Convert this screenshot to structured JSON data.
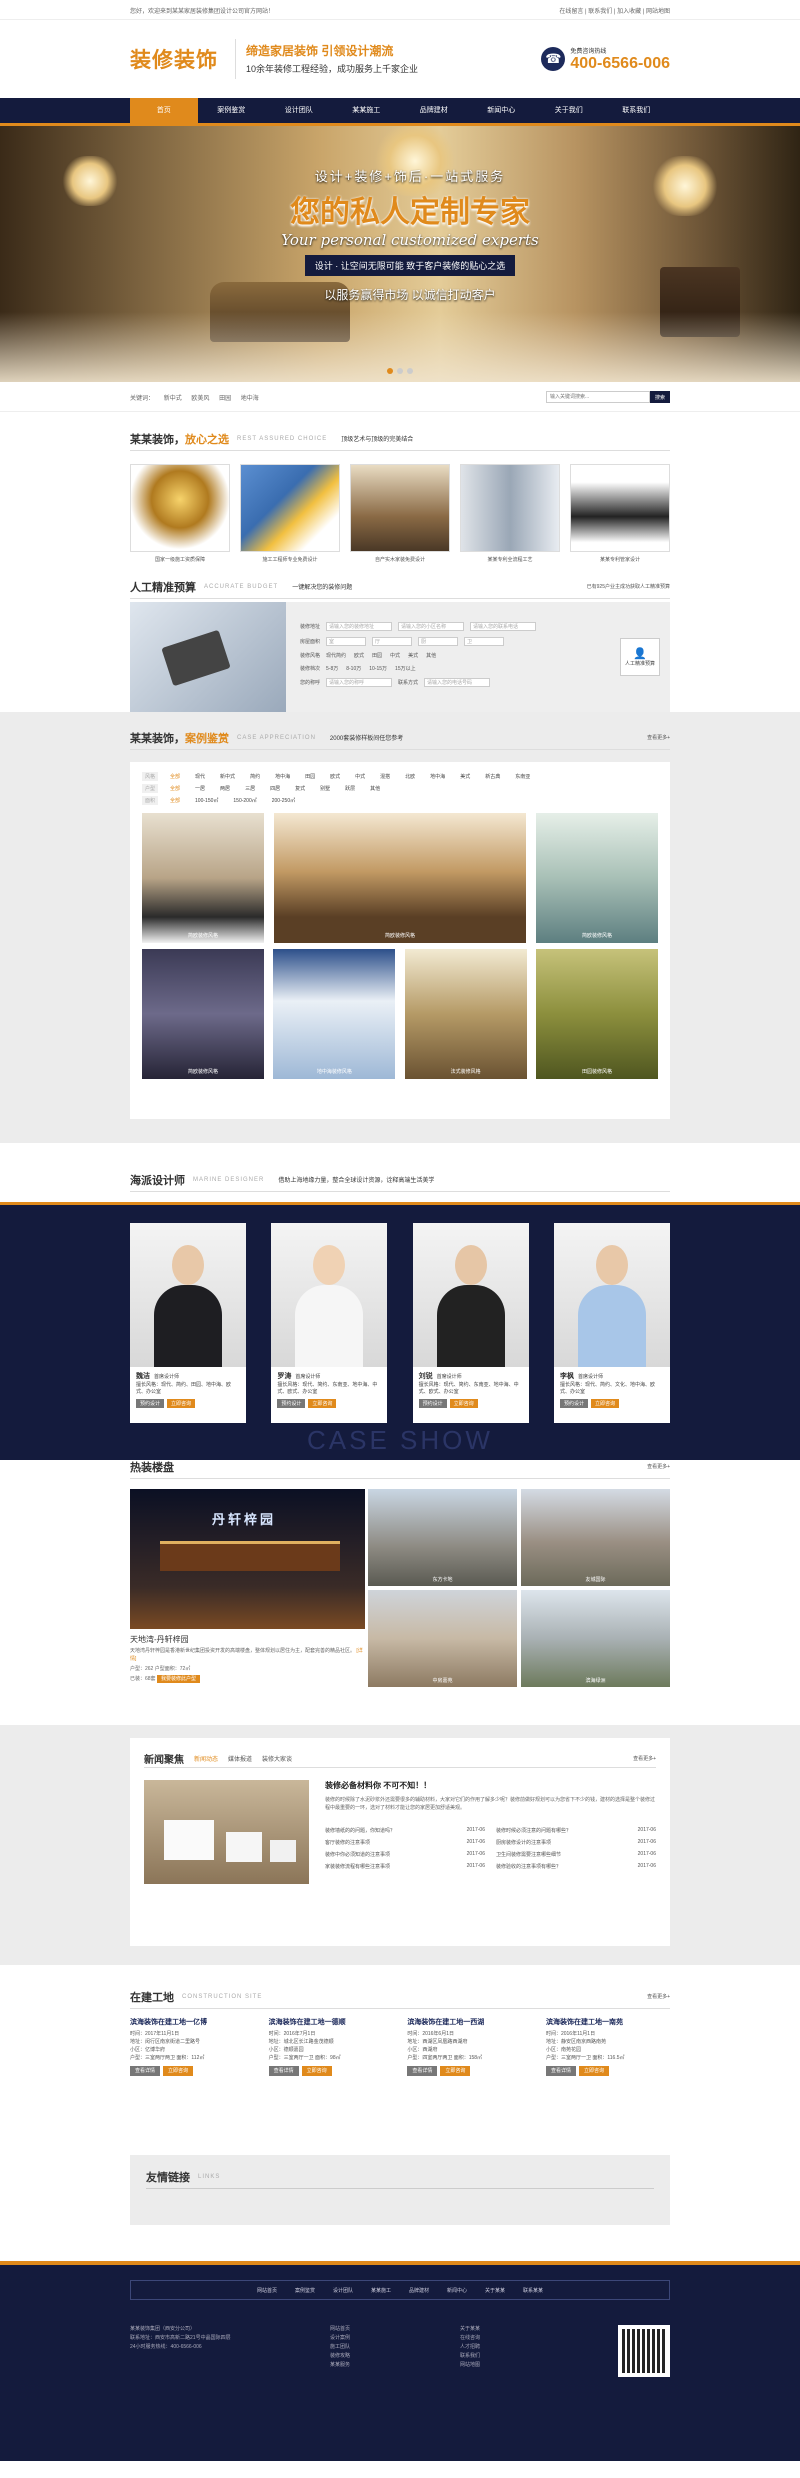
{
  "topbar": {
    "left": "您好，欢迎来到某某家居装修集团设计公司官方网站！",
    "right": "在线留言 | 联系我们 | 加入收藏 | 网站地图"
  },
  "header": {
    "logo": "装修装饰",
    "slogan_1": "缔造家居装饰  引领设计潮流",
    "slogan_2": "10余年装修工程经验，成功服务上千家企业",
    "hotline_label": "免费咨询热线",
    "hotline": "400-6566-006"
  },
  "nav": [
    "首页",
    "案例鉴赏",
    "设计团队",
    "某某施工",
    "品牌建材",
    "新闻中心",
    "关于我们",
    "联系我们"
  ],
  "banner": {
    "line1": "设计+装修+饰后·一站式服务",
    "line2": "您的私人定制专家",
    "line3": "Your personal customized experts",
    "line4": "设计 · 让空间无限可能   致于客户装修的贴心之选",
    "line5": "以服务赢得市场   以诚信打动客户"
  },
  "search": {
    "keywords": [
      "关键词：",
      "新中式",
      "欧美风",
      "田园",
      "地中海"
    ],
    "placeholder": "输入关键词搜索...",
    "button": "搜索"
  },
  "choice": {
    "title_a": "某某装饰，",
    "title_b": "放心之选",
    "en": "REST ASSURED CHOICE",
    "sub": "顶级艺术与顶级的完美结合",
    "items": [
      {
        "cap": "国家一级施工资质保障"
      },
      {
        "cap": "施工工程师专业免费设计"
      },
      {
        "cap": "自产实木家装免费设计"
      },
      {
        "cap": "某某专利全流程工艺"
      },
      {
        "cap": "某某专利管家设计"
      }
    ]
  },
  "budget": {
    "title": "人工精准预算",
    "en": "ACCURATE BUDGET",
    "sub": "一键解决您的装修问题",
    "right": "已有925户业主成功获取人工精准预算",
    "rows": [
      {
        "label": "装修地址",
        "fields": [
          "请输入您的装修地址",
          "请输入您的小区名称",
          "请输入您的联系电话"
        ]
      },
      {
        "label": "房屋面积",
        "fields": [
          "室",
          "厅",
          "厨",
          "卫"
        ]
      },
      {
        "label": "装修风格",
        "opts": [
          "现代简约",
          "欧式",
          "田园",
          "中式",
          "美式",
          "其他"
        ]
      },
      {
        "label": "装修档次",
        "opts": [
          "5-8万",
          "8-10万",
          "10-15万",
          "15万以上"
        ]
      },
      {
        "label": "您的称呼",
        "fields": [
          "请输入您的称呼",
          "联系方式",
          "请输入您的电话号码"
        ]
      }
    ],
    "button": "人工精准预算"
  },
  "cases": {
    "title_a": "某某装饰，",
    "title_b": "案例鉴赏",
    "en": "CASE APPRECIATION",
    "sub": "2000套装修样板间任您参考",
    "more": "查看更多+",
    "filters": [
      [
        "风格",
        "全部",
        "现代",
        "新中式",
        "简约",
        "地中海",
        "田园",
        "欧式",
        "中式",
        "混搭",
        "北欧",
        "地中海",
        "美式",
        "新古典",
        "东南亚"
      ],
      [
        "户型",
        "全部",
        "一居",
        "两居",
        "三居",
        "四居",
        "复式",
        "别墅",
        "跃层",
        "其他"
      ],
      [
        "面积",
        "全部",
        "100-150㎡",
        "150-200㎡",
        "200-250㎡"
      ]
    ],
    "items": [
      {
        "name": "简欧装修风格"
      },
      {
        "name": "简欧装修风格"
      },
      {
        "name": "简欧装修风格"
      },
      {
        "name": "简欧装修风格"
      },
      {
        "name": "地中海装修风格"
      },
      {
        "name": "法式装修风格"
      },
      {
        "name": "田园装修风格"
      }
    ]
  },
  "designers": {
    "title": "海派设计师",
    "en": "MARINE DESIGNER",
    "sub": "借助上海地缘力量，整合全球设计资源，诠释高端生活美学",
    "bg_text": "CASE SHOW",
    "items": [
      {
        "name": "魏洁",
        "role": "首席设计师",
        "desc": "擅长风格：现代、简约、田园、地中海、欧式、办公室",
        "b1": "预约设计",
        "b2": "立即咨询"
      },
      {
        "name": "罗涛",
        "role": "首席设计师",
        "desc": "擅长风格：现代、简约、东南亚、地中海、中式、欧式、办公室",
        "b1": "预约设计",
        "b2": "立即咨询"
      },
      {
        "name": "刘锐",
        "role": "首席设计师",
        "desc": "擅长风格：现代、简约、东南亚、地中海、中式、欧式、办公室",
        "b1": "预约设计",
        "b2": "立即咨询"
      },
      {
        "name": "李枫",
        "role": "首席设计师",
        "desc": "擅长风格：现代、简约、文化、地中海、欧式、办公室",
        "b1": "预约设计",
        "b2": "立即咨询"
      }
    ]
  },
  "property": {
    "title": "热装楼盘",
    "more": "查看更多+",
    "big": {
      "sign": "丹轩梓园",
      "title": "天地湾-丹轩梓园",
      "desc": "天地湾丹轩梓园是香港新世纪集团投资开发的高端楼盘，整体规划以居住为主，配套完善的精品社区。",
      "detail": "[详情]",
      "stat": "户型：262   户型面积：72㎡",
      "stat2": "已装：68套",
      "btn": "我要装修此户型"
    },
    "items": [
      {
        "name": "东方卡地"
      },
      {
        "name": "友城国际"
      },
      {
        "name": "中房嘉苑"
      },
      {
        "name": "滨海绿洲"
      }
    ]
  },
  "news": {
    "title": "新闻聚焦",
    "tabs": [
      "新闻动态",
      "媒体报道",
      "装修大家谈"
    ],
    "more": "查看更多+",
    "headline": "装修必备材料你 不可不知！！",
    "summary": "装修的时候除了水泥砂浆外还需要很多的辅助材料，大家对它们的作用了解多少呢？装修前做好规划可以为您省下不少的钱，建材的选择是整个装修过程中最重要的一环，选对了材料才能让您的家居更加舒适美观。",
    "list": [
      {
        "t": "装修墙纸的的问题，你知道吗？",
        "d": "2017-06"
      },
      {
        "t": "装修时候必须注意的问题有哪些？",
        "d": "2017-06"
      },
      {
        "t": "客厅装修的注意事项",
        "d": "2017-06"
      },
      {
        "t": "厨房装修设计的注意事项",
        "d": "2017-06"
      },
      {
        "t": "装修中你必须知道的注意事项",
        "d": "2017-06"
      },
      {
        "t": "卫生间装修需要注意哪些细节",
        "d": "2017-06"
      },
      {
        "t": "家装装修流程有哪些注意事项",
        "d": "2017-06"
      },
      {
        "t": "装修验收的注意事项有哪些？",
        "d": "2017-06"
      }
    ]
  },
  "sites": {
    "title": "在建工地",
    "en": "CONSTRUCTION SITE",
    "more": "查看更多+",
    "items": [
      {
        "title": "滨海装饰在建工地一亿博",
        "l1": "时间：2017年11月1日",
        "l2": "地址：闵行区南京街道二里路号",
        "l3": "小区：亿博华府",
        "l4": "户型：三室两厅两卫 面积：112㎡",
        "b1": "查看详情",
        "b2": "立即咨询"
      },
      {
        "title": "滨海装饰在建工地一德顺",
        "l1": "时间：2016年7月1日",
        "l2": "地址：城北区长江路金茂德顺",
        "l3": "小区：德顺嘉园",
        "l4": "户型：三室两厅一卫 面积：98㎡",
        "b1": "查看详情",
        "b2": "立即咨询"
      },
      {
        "title": "滨海装饰在建工地一西湖",
        "l1": "时间：2016年6月1日",
        "l2": "地址：西湖区凤凰路西湖府",
        "l3": "小区：西湖府",
        "l4": "户型：四室两厅两卫 面积：158㎡",
        "b1": "查看详情",
        "b2": "立即咨询"
      },
      {
        "title": "滨海装饰在建工地一南苑",
        "l1": "时间：2016年11月1日",
        "l2": "地址：静安区南京西路南苑",
        "l3": "小区：南苑花园",
        "l4": "户型：三室两厅一卫 面积：116.5㎡",
        "b1": "查看详情",
        "b2": "立即咨询"
      }
    ]
  },
  "links": {
    "title": "友情链接",
    "en": "LINKS"
  },
  "footer": {
    "nav": [
      "网站首页",
      "案例鉴赏",
      "设计团队",
      "某某施工",
      "品牌建材",
      "新闻中心",
      "关于某某",
      "联系某某"
    ],
    "company": "某某装饰集团（西安分公司）",
    "addr": "联系地址：西安市高新二路21号中晶国际四层",
    "tel": "24小时服务热线：400-6566-006",
    "col2": [
      "网站首页",
      "设计案例",
      "施工团队",
      "装修攻略",
      "某某服务"
    ],
    "col3": [
      "关于某某",
      "在线咨询",
      "人才招聘",
      "联系我们",
      "网站地图"
    ]
  },
  "colors": {
    "accent": "#e08a1c",
    "navy": "#141b3d"
  }
}
